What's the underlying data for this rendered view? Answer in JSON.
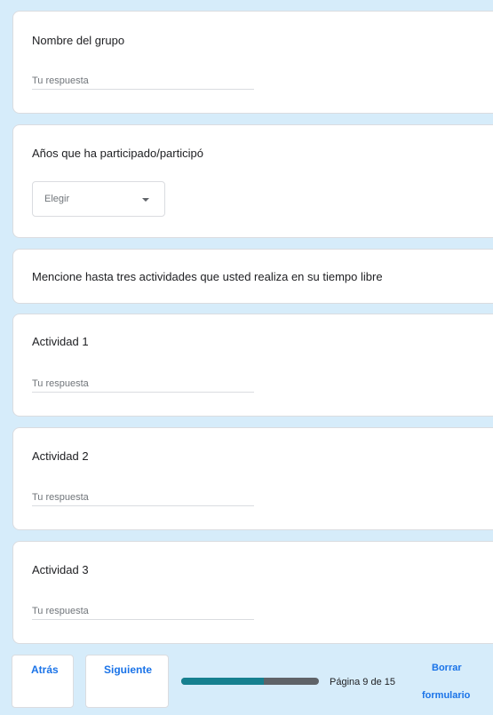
{
  "questions": {
    "group_name": {
      "title": "Nombre del grupo",
      "placeholder": "Tu respuesta"
    },
    "years": {
      "title": "Años que ha participado/participó",
      "dropdown_value": "Elegir"
    },
    "section_header": "Mencione hasta tres actividades que usted realiza en su tiempo libre",
    "activity1": {
      "title": "Actividad 1",
      "placeholder": "Tu respuesta"
    },
    "activity2": {
      "title": "Actividad 2",
      "placeholder": "Tu respuesta"
    },
    "activity3": {
      "title": "Actividad 3",
      "placeholder": "Tu respuesta"
    }
  },
  "footer": {
    "back_label": "Atrás",
    "next_label": "Siguiente",
    "page_indicator": "Página 9 de 15",
    "progress_fraction": 0.6,
    "clear_label_line1": "Borrar",
    "clear_label_line2": "formulario"
  },
  "colors": {
    "background": "#d6ecfa",
    "accent": "#1a73e8",
    "progress_fill": "#16808f",
    "progress_track": "#5f6368"
  },
  "icons": {
    "dropdown_caret": "caret-down-icon"
  }
}
